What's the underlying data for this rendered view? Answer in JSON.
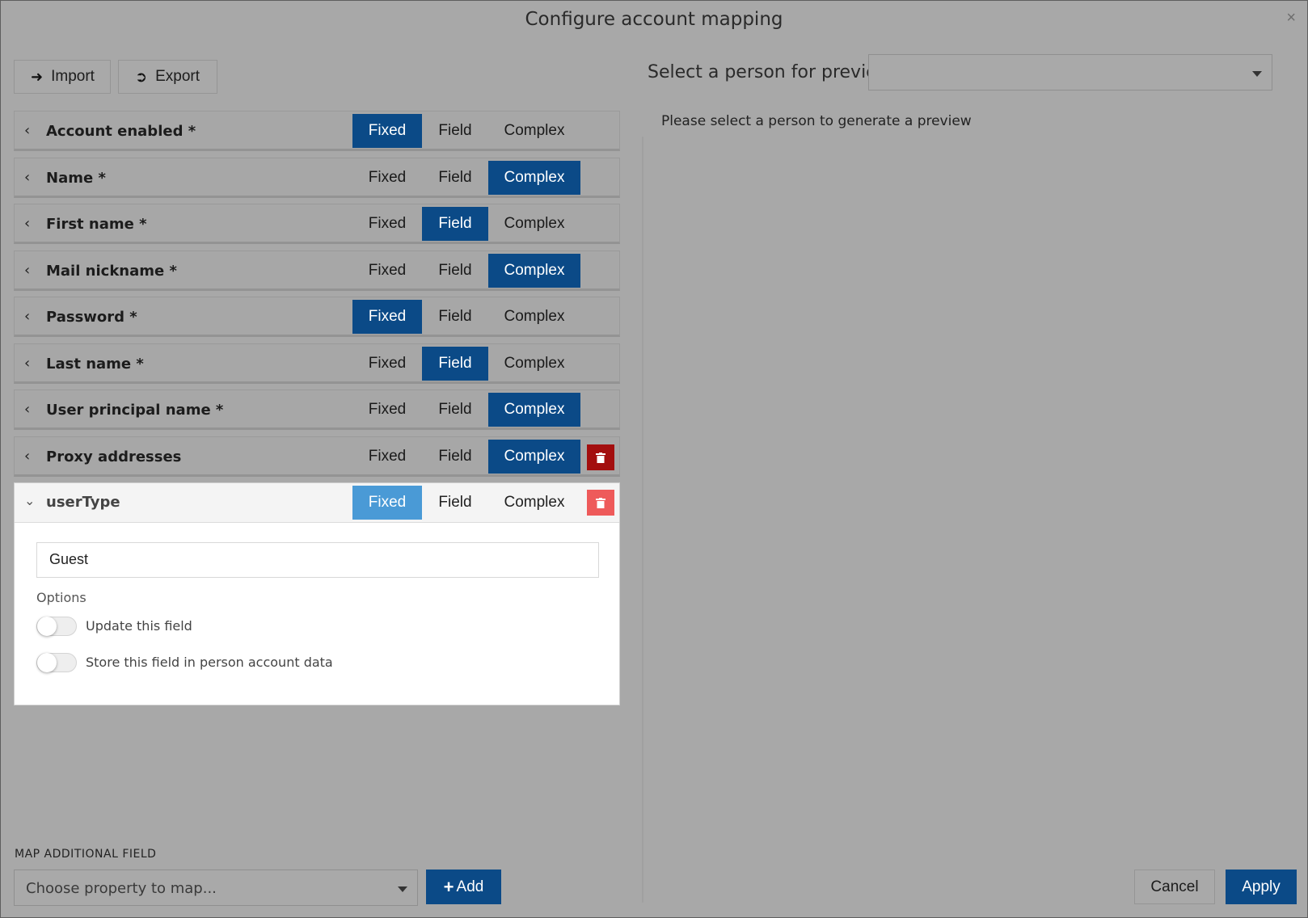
{
  "dialog": {
    "title": "Configure account mapping",
    "close_glyph": "×"
  },
  "toolbar": {
    "import_label": "Import",
    "export_label": "Export"
  },
  "segment_labels": {
    "fixed": "Fixed",
    "field": "Field",
    "complex": "Complex"
  },
  "mappings": [
    {
      "label": "Account enabled *",
      "mode": "Fixed",
      "deletable": false
    },
    {
      "label": "Name *",
      "mode": "Complex",
      "deletable": false
    },
    {
      "label": "First name *",
      "mode": "Field",
      "deletable": false
    },
    {
      "label": "Mail nickname *",
      "mode": "Complex",
      "deletable": false
    },
    {
      "label": "Password *",
      "mode": "Fixed",
      "deletable": false
    },
    {
      "label": "Last name *",
      "mode": "Field",
      "deletable": false
    },
    {
      "label": "User principal name *",
      "mode": "Complex",
      "deletable": false
    },
    {
      "label": "Proxy addresses",
      "mode": "Complex",
      "deletable": true
    }
  ],
  "expanded_mapping": {
    "label": "userType",
    "mode": "Fixed",
    "deletable": true,
    "value": "Guest",
    "options_label": "Options",
    "options": [
      {
        "label": "Update this field",
        "enabled": false
      },
      {
        "label": "Store this field in person account data",
        "enabled": false
      }
    ]
  },
  "preview": {
    "label": "Select a person for preview",
    "selected": "",
    "message": "Please select a person to generate a preview"
  },
  "map_additional": {
    "label": "MAP ADDITIONAL FIELD",
    "placeholder": "Choose property to map...",
    "add_label": "Add"
  },
  "footer": {
    "cancel_label": "Cancel",
    "apply_label": "Apply"
  },
  "icons": {
    "import": "sign-in-icon",
    "export": "sign-out-icon",
    "chevron_collapsed": "chevron-left-icon",
    "chevron_expanded": "chevron-down-icon",
    "delete": "trash-icon",
    "dropdown": "caret-down-icon",
    "add": "plus-icon"
  },
  "colors": {
    "primary": "#0b4a87",
    "primary_light": "#4a9ad6",
    "danger": "#a30e0e",
    "danger_light": "#ee5a5a"
  }
}
